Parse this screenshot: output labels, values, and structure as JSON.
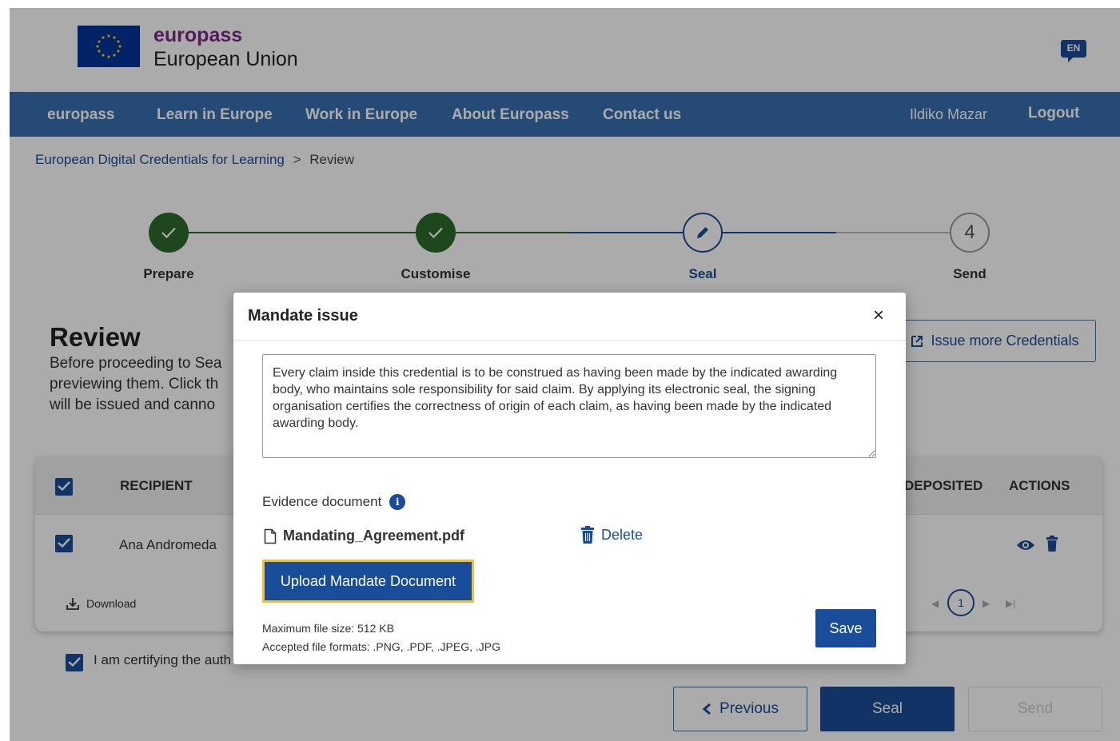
{
  "header": {
    "brand_top": "europass",
    "brand_bottom": "European Union",
    "language": "EN"
  },
  "nav": {
    "items": [
      "europass",
      "Learn in Europe",
      "Work in Europe",
      "About Europass",
      "Contact us"
    ],
    "user": "Ildiko Mazar",
    "logout": "Logout"
  },
  "breadcrumb": {
    "parent": "European Digital Credentials for Learning",
    "separator": ">",
    "current": "Review"
  },
  "stepper": {
    "steps": [
      {
        "label": "Prepare",
        "state": "done"
      },
      {
        "label": "Customise",
        "state": "done"
      },
      {
        "label": "Seal",
        "state": "active"
      },
      {
        "label": "Send",
        "state": "pending",
        "number": "4"
      }
    ]
  },
  "review": {
    "title": "Review",
    "desc_line1": "Before proceeding to Sea",
    "desc_line2": "previewing them. Click th",
    "desc_line3": "will be issued and canno",
    "issue_more": "Issue more Credentials"
  },
  "table": {
    "headers": {
      "recipient": "RECIPIENT",
      "deposited": "DEPOSITED",
      "actions": "ACTIONS"
    },
    "rows": [
      {
        "recipient": "Ana Andromeda"
      }
    ],
    "download": "Download",
    "page": "1"
  },
  "certify_text": "I am certifying the auth",
  "buttons": {
    "previous": "Previous",
    "seal": "Seal",
    "send": "Send"
  },
  "modal": {
    "title": "Mandate issue",
    "close": "×",
    "mandate_text": "Every claim inside this credential is to be construed as having been made by the indicated awarding body, who maintains sole responsibility for said claim. By applying its electronic seal, the signing organisation certifies the correctness of origin of each claim, as having been made by the indicated awarding body.",
    "evidence_label": "Evidence document",
    "info": "i",
    "file_name": "Mandating_Agreement.pdf",
    "delete": "Delete",
    "upload": "Upload Mandate Document",
    "max_size": "Maximum file size: 512 KB",
    "formats": "Accepted file formats: .PNG, .PDF, .JPEG, .JPG",
    "save": "Save"
  },
  "colors": {
    "primary": "#1a4d99",
    "nav": "#3a6fb0",
    "brand_purple": "#7d2a8a",
    "done_green": "#2d6b2d",
    "focus_yellow": "#f0c232"
  }
}
